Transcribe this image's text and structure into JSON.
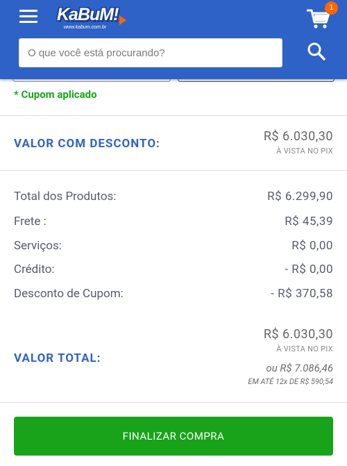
{
  "header": {
    "logo_text": "KaBuM!",
    "logo_url": "www.kabum.com.br",
    "cart_count": "1",
    "search_placeholder": "O que você está procurando?"
  },
  "coupon": {
    "applied_text": "* Cupom aplicado"
  },
  "discount_summary": {
    "label": "VALOR COM DESCONTO:",
    "value": "R$ 6.030,30",
    "note": "À VISTA NO PIX"
  },
  "breakdown": [
    {
      "label": "Total dos Produtos:",
      "value": "R$ 6.299,90"
    },
    {
      "label": "Frete :",
      "value": "R$ 45,39"
    },
    {
      "label": "Serviços:",
      "value": "R$ 0,00"
    },
    {
      "label": "Crédito:",
      "value": "- R$ 0,00"
    },
    {
      "label": "Desconto de Cupom:",
      "value": "- R$ 370,58"
    }
  ],
  "total": {
    "label": "VALOR TOTAL:",
    "value": "R$ 6.030,30",
    "note": "À VISTA NO PIX",
    "installment_total": "ou R$ 7.086,46",
    "installment_detail": "EM ATÉ 12x DE R$ 590,54"
  },
  "actions": {
    "finish_label": "FINALIZAR COMPRA"
  },
  "colors": {
    "header_bg": "#2f62c7",
    "accent_orange": "#ff6500",
    "success_green": "#16a51b",
    "button_green": "#19a31b",
    "label_blue": "#2f62c7"
  }
}
